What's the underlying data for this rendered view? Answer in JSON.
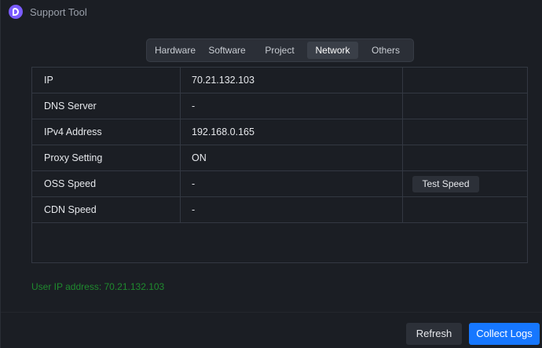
{
  "window": {
    "title": "Support Tool",
    "logo_icon": "app-logo-icon",
    "accent_color": "#1677ff",
    "logo_color": "#7b5cff"
  },
  "tabs": [
    {
      "label": "Hardware",
      "active": false
    },
    {
      "label": "Software",
      "active": false
    },
    {
      "label": "Project",
      "active": false
    },
    {
      "label": "Network",
      "active": true
    },
    {
      "label": "Others",
      "active": false
    }
  ],
  "network_table": {
    "rows": [
      {
        "name": "IP",
        "value": "70.21.132.103"
      },
      {
        "name": "DNS Server",
        "value": "-"
      },
      {
        "name": "IPv4 Address",
        "value": "192.168.0.165"
      },
      {
        "name": "Proxy Setting",
        "value": "ON"
      },
      {
        "name": "OSS Speed",
        "value": "-",
        "action": "Test Speed"
      },
      {
        "name": "CDN Speed",
        "value": "-"
      }
    ]
  },
  "status": {
    "user_ip_text": "User IP address: 70.21.132.103",
    "color": "#1f8a2e"
  },
  "footer": {
    "refresh_label": "Refresh",
    "collect_label": "Collect Logs"
  }
}
